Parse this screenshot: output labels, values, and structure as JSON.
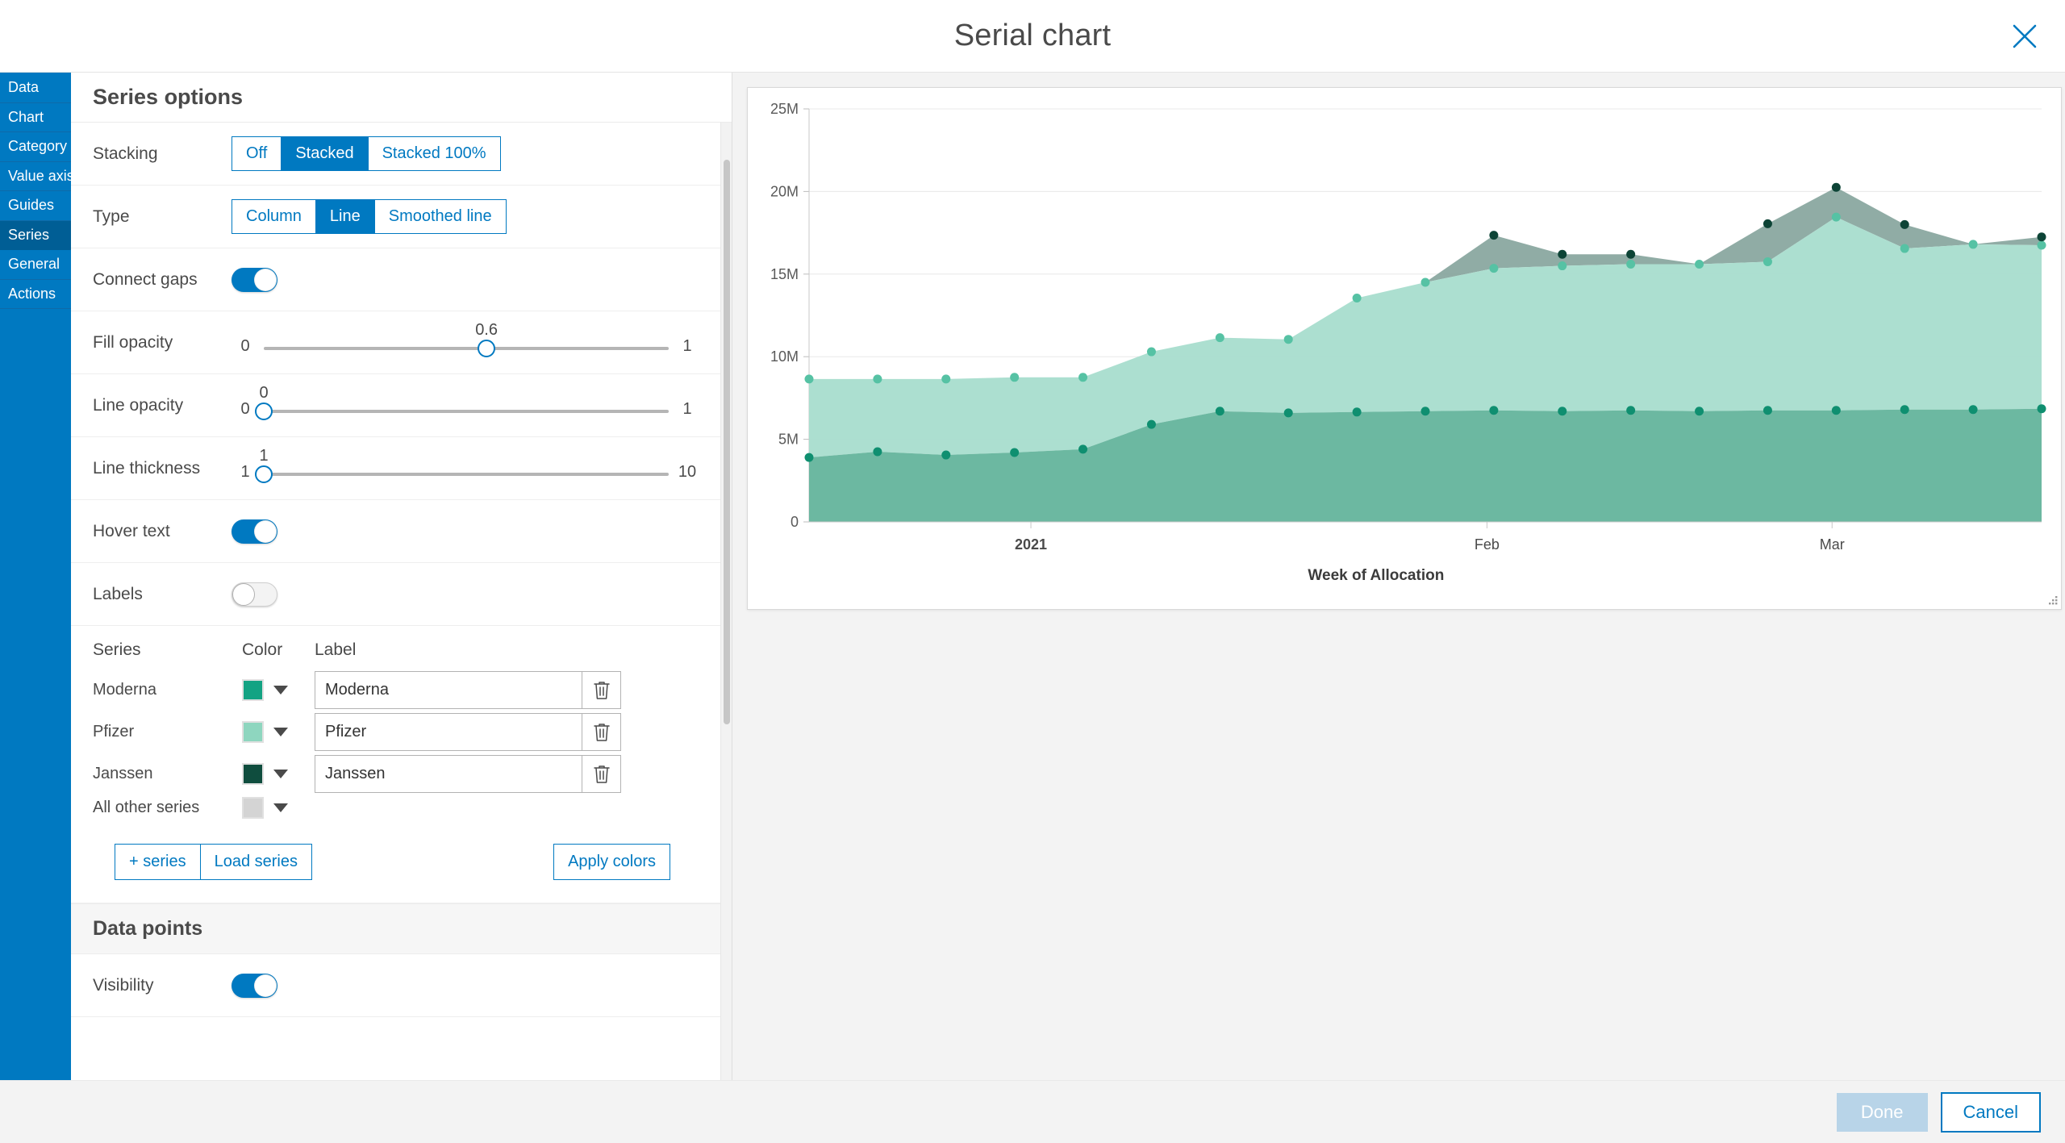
{
  "header": {
    "title": "Serial chart",
    "close_icon": "close-icon"
  },
  "sidebar": {
    "items": [
      {
        "label": "Data",
        "active": false
      },
      {
        "label": "Chart",
        "active": false
      },
      {
        "label": "Category axis",
        "active": false
      },
      {
        "label": "Value axis",
        "active": false
      },
      {
        "label": "Guides",
        "active": false
      },
      {
        "label": "Series",
        "active": true
      },
      {
        "label": "General",
        "active": false
      },
      {
        "label": "Actions",
        "active": false
      }
    ]
  },
  "options": {
    "pane_title": "Series options",
    "stacking": {
      "label": "Stacking",
      "options": [
        "Off",
        "Stacked",
        "Stacked 100%"
      ],
      "selected": "Stacked"
    },
    "type": {
      "label": "Type",
      "options": [
        "Column",
        "Line",
        "Smoothed line"
      ],
      "selected": "Line"
    },
    "connect_gaps": {
      "label": "Connect gaps",
      "value": "on"
    },
    "fill_opacity": {
      "label": "Fill opacity",
      "min": "0",
      "max": "1",
      "value": "0.6",
      "pct": 55
    },
    "line_opacity": {
      "label": "Line opacity",
      "min": "0",
      "max": "1",
      "value": "0",
      "pct": 0
    },
    "line_thickness": {
      "label": "Line thickness",
      "min": "1",
      "max": "10",
      "value": "1",
      "pct": 0
    },
    "hover_text": {
      "label": "Hover text",
      "value": "on"
    },
    "labels": {
      "label": "Labels",
      "value": "off"
    },
    "series_table": {
      "headers": {
        "series": "Series",
        "color": "Color",
        "label": "Label"
      },
      "rows": [
        {
          "name": "Moderna",
          "color": "#13a383",
          "label": "Moderna",
          "deletable": true
        },
        {
          "name": "Pfizer",
          "color": "#8ed6bf",
          "label": "Pfizer",
          "deletable": true
        },
        {
          "name": "Janssen",
          "color": "#0f4d3e",
          "label": "Janssen",
          "deletable": true
        },
        {
          "name": "All other series",
          "color": "#d4d4d4",
          "label": "",
          "deletable": false
        }
      ]
    },
    "buttons": {
      "add_series": "+ series",
      "load_series": "Load series",
      "apply_colors": "Apply colors"
    },
    "data_points": {
      "title": "Data points",
      "visibility_label": "Visibility",
      "visibility": "on"
    }
  },
  "footer": {
    "done": "Done",
    "cancel": "Cancel",
    "done_disabled": true
  },
  "chart_data": {
    "type": "area",
    "title": "",
    "xlabel": "Week of Allocation",
    "ylabel": "",
    "ylim": [
      0,
      25000000
    ],
    "yticks": [
      0,
      5000000,
      10000000,
      15000000,
      20000000,
      25000000
    ],
    "ytick_labels": [
      "0",
      "5M",
      "10M",
      "15M",
      "20M",
      "25M"
    ],
    "xtick_labels": [
      "2021",
      "Feb",
      "Mar"
    ],
    "xtick_positions": [
      0.18,
      0.55,
      0.83
    ],
    "grid": true,
    "legend": "none",
    "stacked": true,
    "x": [
      0,
      1,
      2,
      3,
      4,
      5,
      6,
      7,
      8,
      9,
      10,
      11,
      12,
      13,
      14,
      15,
      16,
      17,
      18
    ],
    "series": [
      {
        "name": "Moderna",
        "color": "#64b49c",
        "values": [
          3900000,
          4250000,
          4050000,
          4200000,
          4400000,
          5900000,
          6700000,
          6600000,
          6650000,
          6700000,
          6750000,
          6700000,
          6750000,
          6700000,
          6750000,
          6750000,
          6800000,
          6800000,
          6850000
        ]
      },
      {
        "name": "Pfizer",
        "color": "#a8ddcd",
        "values": [
          4750000,
          4400000,
          4600000,
          4550000,
          4350000,
          4400000,
          4450000,
          4450000,
          6900000,
          7800000,
          8600000,
          8800000,
          8850000,
          8900000,
          9000000,
          11700000,
          9750000,
          10000000,
          9900000
        ]
      },
      {
        "name": "Janssen",
        "color": "#7d9e95",
        "values": [
          0,
          0,
          0,
          0,
          0,
          0,
          0,
          0,
          0,
          0,
          2000000,
          700000,
          600000,
          0,
          2300000,
          1800000,
          1450000,
          0,
          500000
        ]
      }
    ],
    "stacked_totals": {
      "moderna_top": [
        3900000,
        4250000,
        4050000,
        4200000,
        4400000,
        5900000,
        6700000,
        6600000,
        6650000,
        6700000,
        6750000,
        6700000,
        6750000,
        6700000,
        6750000,
        6750000,
        6800000,
        6800000,
        6850000
      ],
      "pfizer_top": [
        8650000,
        8650000,
        8650000,
        8750000,
        8750000,
        10300000,
        11150000,
        11050000,
        13550000,
        14500000,
        15350000,
        15500000,
        15600000,
        15600000,
        15750000,
        18450000,
        16550000,
        16800000,
        16750000
      ],
      "janssen_top": [
        8650000,
        8650000,
        8650000,
        8750000,
        8750000,
        10300000,
        11150000,
        11050000,
        13550000,
        14500000,
        17350000,
        16200000,
        16200000,
        15600000,
        18050000,
        20250000,
        18000000,
        16800000,
        17250000
      ]
    }
  }
}
